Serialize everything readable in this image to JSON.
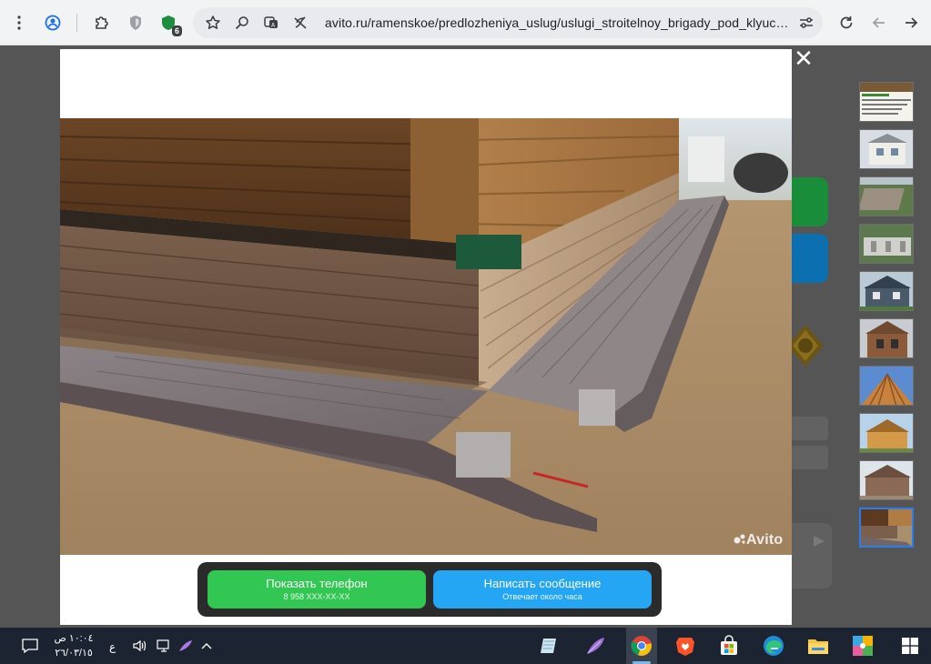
{
  "browser": {
    "url": "avito.ru/ramenskoe/predlozheniya_uslug/uslugi_stroitelnoy_brigady_pod_klyuch_...",
    "extension_badge_count": "6",
    "icons": [
      "menu-dots-icon",
      "profile-icon",
      "extensions-icon",
      "shield-extension-icon",
      "green-extension-icon",
      "bookmark-star-icon",
      "zoom-icon",
      "translate-icon",
      "page-off-icon",
      "site-settings-icon",
      "reload-icon",
      "back-icon",
      "forward-icon"
    ]
  },
  "viewer": {
    "close_label": "✕",
    "watermark": "Avito",
    "thumbnail_count": 10,
    "active_thumbnail_index": 9,
    "phone_button": {
      "label": "Показать телефон",
      "sub": "8 958 XXX-XX-XX"
    },
    "message_button": {
      "label": "Написать сообщение",
      "sub": "Отвечает около часа"
    }
  },
  "taskbar": {
    "clock_time": "١٠:٠٤ ص",
    "clock_date": "٢٦/٠٣/١٥",
    "lang": "ع",
    "icons": [
      "notifications-icon",
      "volume-icon",
      "network-icon",
      "pen-icon",
      "chevron-up-icon",
      "notepad-app-icon",
      "feather-app-icon",
      "chrome-app-icon",
      "brave-app-icon",
      "store-app-icon",
      "edge-app-icon",
      "explorer-app-icon",
      "puzzle-app-icon",
      "windows-start-icon"
    ]
  },
  "colors": {
    "phone_button": "#32c753",
    "message_button": "#24a6f5",
    "taskbar": "#1c2331"
  }
}
